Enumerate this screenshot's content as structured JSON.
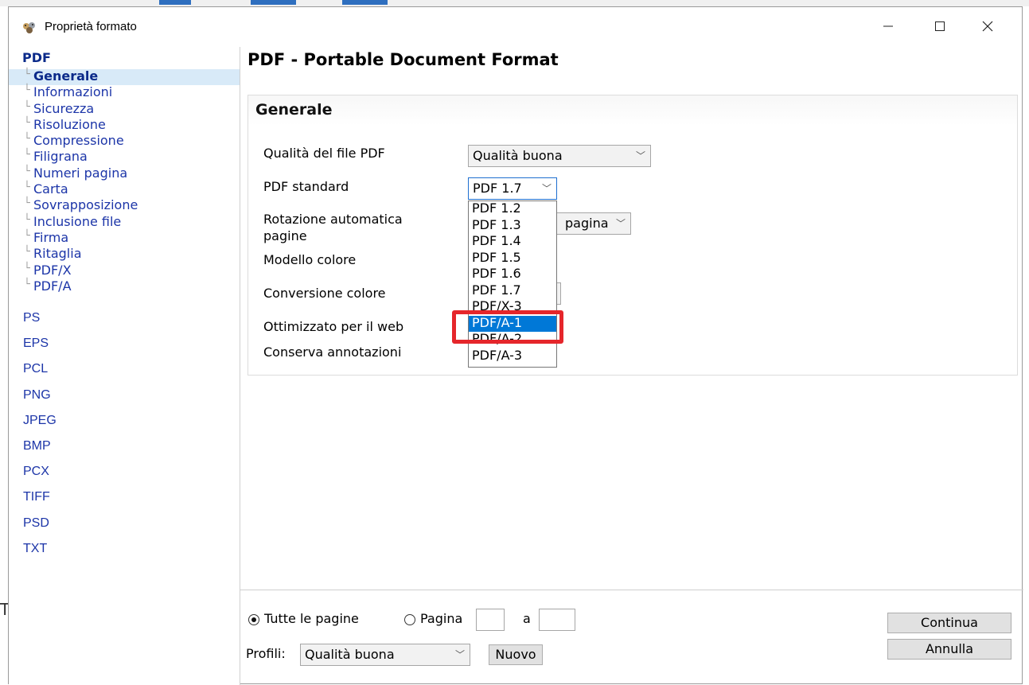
{
  "window": {
    "title": "Proprietà formato"
  },
  "sidebar": {
    "group_title": "PDF",
    "sub_items": [
      {
        "label": "Generale",
        "active": true
      },
      {
        "label": "Informazioni"
      },
      {
        "label": "Sicurezza"
      },
      {
        "label": "Risoluzione"
      },
      {
        "label": "Compressione"
      },
      {
        "label": "Filigrana"
      },
      {
        "label": "Numeri pagina"
      },
      {
        "label": "Carta"
      },
      {
        "label": "Sovrapposizione"
      },
      {
        "label": "Inclusione file"
      },
      {
        "label": "Firma"
      },
      {
        "label": "Ritaglia"
      },
      {
        "label": "PDF/X"
      },
      {
        "label": "PDF/A"
      }
    ],
    "formats": [
      "PS",
      "EPS",
      "PCL",
      "PNG",
      "JPEG",
      "BMP",
      "PCX",
      "TIFF",
      "PSD",
      "TXT"
    ]
  },
  "main": {
    "title": "PDF - Portable Document Format",
    "panel_title": "Generale",
    "fields": {
      "quality_label": "Qualità del file PDF",
      "quality_value": "Qualità buona",
      "standard_label": "PDF standard",
      "standard_value": "PDF 1.7",
      "rotation_label": "Rotazione automatica pagine",
      "rotation_value_partial": "pagina",
      "color_model_label": "Modello colore",
      "color_conversion_label": "Conversione colore",
      "web_optimized_label": "Ottimizzato per il web",
      "keep_annotations_label": "Conserva annotazioni"
    },
    "standard_options": [
      "PDF 1.2",
      "PDF 1.3",
      "PDF 1.4",
      "PDF 1.5",
      "PDF 1.6",
      "PDF 1.7",
      "PDF/X-3",
      "PDF/A-1",
      "PDF/A-2",
      "PDF/A-3"
    ],
    "standard_selected_option": "PDF/A-1"
  },
  "bottom": {
    "all_pages_label": "Tutte le pagine",
    "page_label": "Pagina",
    "to_label": "a",
    "profiles_label": "Profili:",
    "profiles_value": "Qualità buona",
    "new_label": "Nuovo",
    "continue_label": "Continua",
    "cancel_label": "Annulla"
  },
  "background": {
    "partial_letter": "T"
  },
  "colors": {
    "accent": "#0078d7",
    "nav_text": "#1c35a8",
    "highlight": "#e5262b",
    "active_row": "#d8eaf8"
  }
}
